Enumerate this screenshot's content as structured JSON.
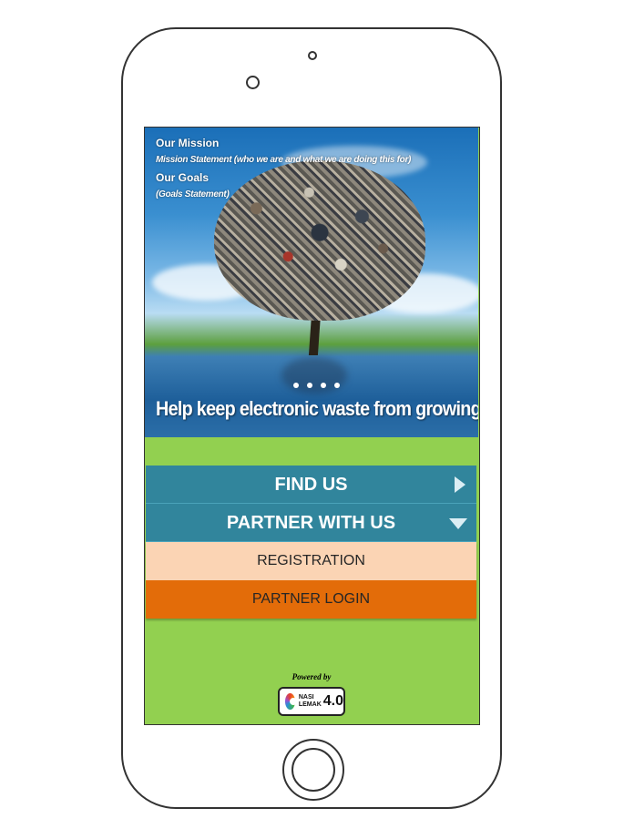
{
  "hero": {
    "mission_title": "Our Mission",
    "mission_statement": "Mission Statement (who we are and what we are doing this for)",
    "goals_title": "Our Goals",
    "goals_statement": "(Goals Statement)",
    "tagline": "Help keep electronic waste from growing.",
    "carousel_dots": 4
  },
  "menu": {
    "find_us": "FIND US",
    "partner_with_us": "PARTNER WITH US",
    "submenu": {
      "registration": "REGISTRATION",
      "partner_login": "PARTNER LOGIN"
    }
  },
  "footer": {
    "powered_by": "Powered by",
    "logo_line1": "NASI",
    "logo_line2": "LEMAK",
    "logo_version": "4.0"
  },
  "colors": {
    "screen_background": "#92d050",
    "menu_background": "#31859c",
    "registration_background": "#fbd4b4",
    "login_background": "#e36c09"
  },
  "icons": {
    "find_us": "chevron-right-icon",
    "partner_with_us": "chevron-down-icon"
  }
}
